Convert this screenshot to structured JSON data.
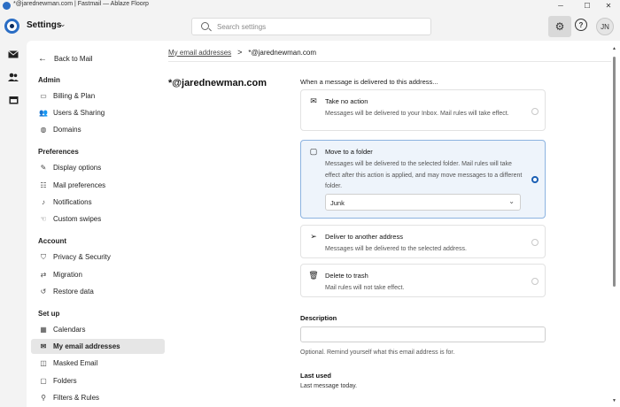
{
  "window": {
    "title": "*@jarednewman.com | Fastmail — Ablaze Floorp",
    "controls": {
      "minimize": "─",
      "maximize": "☐",
      "close": "✕"
    }
  },
  "header": {
    "app_title": "Settings",
    "chevron": "⌄",
    "search_placeholder": "Search settings",
    "gear_icon": "⚙",
    "help_icon": "?",
    "avatar_initials": "JN"
  },
  "rail": {
    "icons": [
      "mail-icon",
      "contacts-icon",
      "calendar-icon"
    ]
  },
  "nav": {
    "back_label": "Back to Mail",
    "back_arrow": "←",
    "sections": [
      {
        "title": "Admin",
        "items": [
          {
            "label": "Billing & Plan",
            "icon": "▭"
          },
          {
            "label": "Users & Sharing",
            "icon": "👥"
          },
          {
            "label": "Domains",
            "icon": "◍"
          }
        ]
      },
      {
        "title": "Preferences",
        "items": [
          {
            "label": "Display options",
            "icon": "✎"
          },
          {
            "label": "Mail preferences",
            "icon": "☷"
          },
          {
            "label": "Notifications",
            "icon": "♪"
          },
          {
            "label": "Custom swipes",
            "icon": "☜"
          }
        ]
      },
      {
        "title": "Account",
        "items": [
          {
            "label": "Privacy & Security",
            "icon": "⛉"
          },
          {
            "label": "Migration",
            "icon": "⇄"
          },
          {
            "label": "Restore data",
            "icon": "↺"
          }
        ]
      },
      {
        "title": "Set up",
        "items": [
          {
            "label": "Calendars",
            "icon": "▦"
          },
          {
            "label": "My email addresses",
            "icon": "✉"
          },
          {
            "label": "Masked Email",
            "icon": "◫"
          },
          {
            "label": "Folders",
            "icon": "▢"
          },
          {
            "label": "Filters & Rules",
            "icon": "⚲"
          }
        ]
      }
    ],
    "active_item": "My email addresses"
  },
  "content": {
    "breadcrumb": {
      "parent": "My email addresses",
      "separator": ">",
      "current": "*@jarednewman.com"
    },
    "address_title": "*@jarednewman.com",
    "delivery_prompt": "When a message is delivered to this address...",
    "options": [
      {
        "title": "Take no action",
        "description": "Messages will be delivered to your Inbox. Mail rules will take effect.",
        "icon": "✉",
        "selected": false
      },
      {
        "title": "Move to a folder",
        "description": "Messages will be delivered to the selected folder. Mail rules will take effect after this action is applied, and may move messages to a different folder.",
        "icon": "▢",
        "selected": true
      },
      {
        "title": "Deliver to another address",
        "description": "Messages will be delivered to the selected address.",
        "icon": "➢",
        "selected": false
      },
      {
        "title": "Delete to trash",
        "description": "Mail rules will not take effect.",
        "icon": "🗑",
        "selected": false
      }
    ],
    "folder_select": {
      "value": "Junk",
      "chevron": "⌄"
    },
    "description_label": "Description",
    "description_value": "",
    "description_help": "Optional. Remind yourself what this email address is for.",
    "last_used_label": "Last used",
    "last_used_value": "Last message today."
  },
  "colors": {
    "accent": "#1a5fb4",
    "selected_option_bg": "#eef4fb",
    "nav_active_bg": "#e6e6e6",
    "brand": "#2a6dc4"
  }
}
